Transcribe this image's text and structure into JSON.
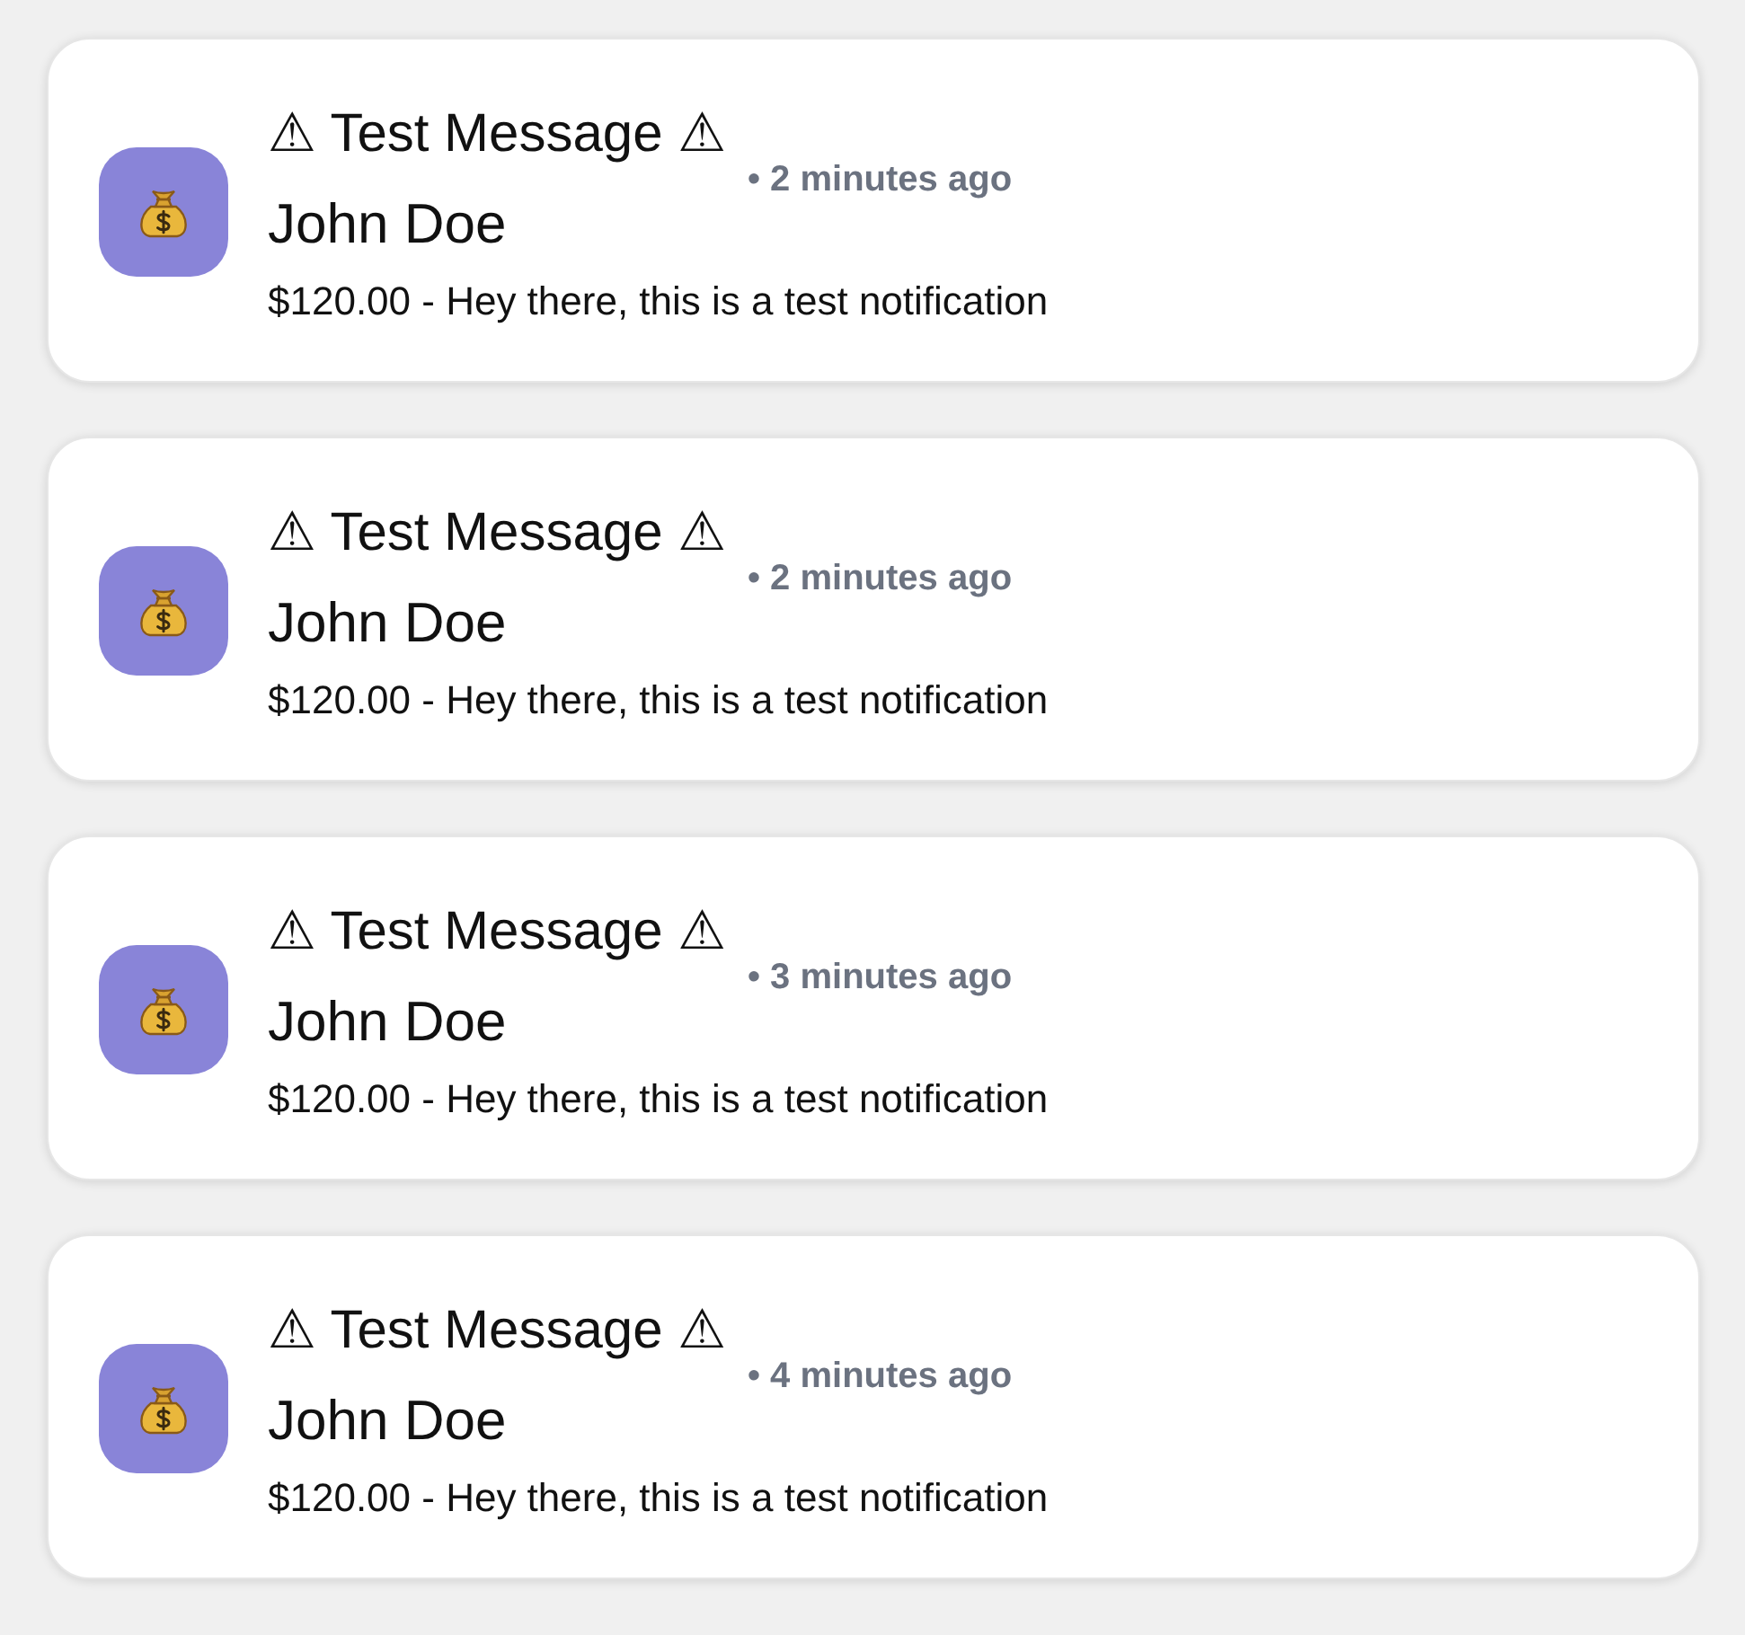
{
  "notifications": [
    {
      "title": "⚠ Test Message ⚠",
      "time": "• 2 minutes ago",
      "sender": "John Doe",
      "message": "$120.00 - Hey there, this is a test notification"
    },
    {
      "title": "⚠ Test Message ⚠",
      "time": "• 2 minutes ago",
      "sender": "John Doe",
      "message": "$120.00 - Hey there, this is a test notification"
    },
    {
      "title": "⚠ Test Message ⚠",
      "time": "• 3 minutes ago",
      "sender": "John Doe",
      "message": "$120.00 - Hey there, this is a test notification"
    },
    {
      "title": "⚠ Test Message ⚠",
      "time": "• 4 minutes ago",
      "sender": "John Doe",
      "message": "$120.00 - Hey there, this is a test notification"
    }
  ]
}
